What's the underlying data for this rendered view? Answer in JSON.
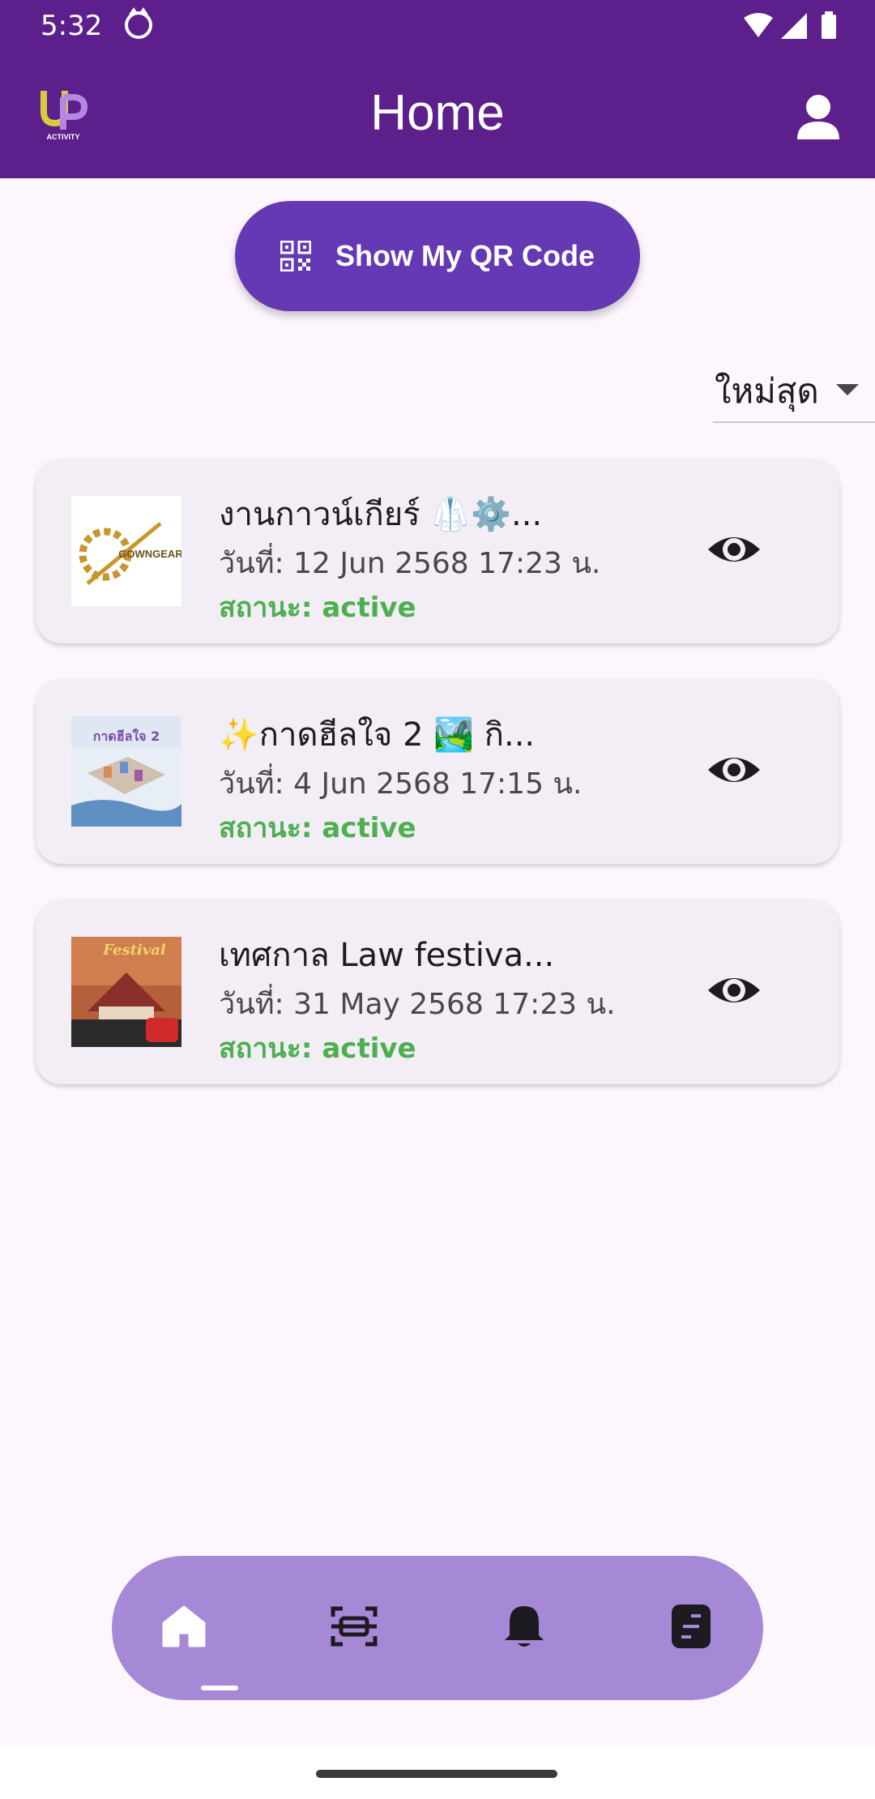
{
  "status_bar": {
    "time": "5:32"
  },
  "app_bar": {
    "title": "Home",
    "logo_label": "ACTIVITY"
  },
  "qr_button": {
    "label": "Show My QR Code"
  },
  "sort": {
    "selected": "ใหม่สุด"
  },
  "activities": [
    {
      "title": "งานกาวน์เกียร์ 🥼⚙️...",
      "date": "วันที่: 12 Jun 2568 17:23 น.",
      "status": "สถานะ: active",
      "thumb_text": "GOWNGEAR"
    },
    {
      "title": "✨กาดฮีลใจ 2 🏞️ กิ...",
      "date": "วันที่: 4 Jun 2568 17:15 น.",
      "status": "สถานะ: active",
      "thumb_text": "กาดฮีลใจ 2"
    },
    {
      "title": "เทศกาล Law festiva...",
      "date": "วันที่: 31 May 2568 17:23 น.",
      "status": "สถานะ: active",
      "thumb_text": "Festival"
    }
  ],
  "colors": {
    "app_bar": "#5d1f8c",
    "qr_button": "#6539b3",
    "status_active": "#4caf50",
    "bottom_nav": "#a588d6",
    "card": "#f3edf5"
  },
  "bottom_nav": {
    "items": [
      {
        "icon": "home-icon",
        "active": true
      },
      {
        "icon": "scan-icon",
        "active": false
      },
      {
        "icon": "bell-icon",
        "active": false
      },
      {
        "icon": "document-icon",
        "active": false
      }
    ]
  }
}
